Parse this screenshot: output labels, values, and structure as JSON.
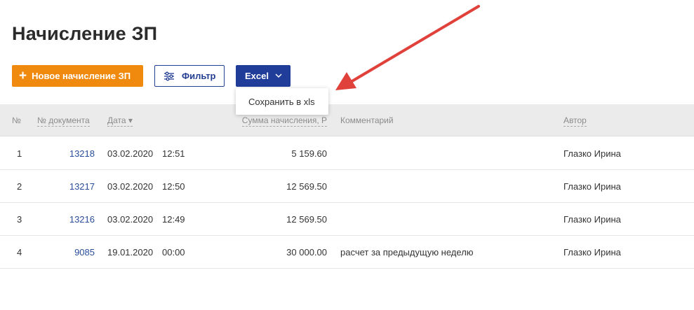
{
  "page": {
    "title": "Начисление ЗП"
  },
  "toolbar": {
    "new_label": "Новое начисление ЗП",
    "new_icon": "plus-icon",
    "filter_label": "Фильтр",
    "filter_icon": "sliders-icon",
    "excel_label": "Excel",
    "excel_icon": "chevron-down-icon"
  },
  "dropdown": {
    "items": [
      {
        "label": "Сохранить в xls"
      }
    ]
  },
  "table": {
    "headers": {
      "num": "№",
      "doc": "№ документа",
      "date": "Дата ▾",
      "sum": "Сумма начисления, Р",
      "comment": "Комментарий",
      "author": "Автор"
    },
    "rows": [
      {
        "num": "1",
        "doc": "13218",
        "date": "03.02.2020",
        "time": "12:51",
        "sum": "5 159.60",
        "comment": "",
        "author": "Глазко Ирина"
      },
      {
        "num": "2",
        "doc": "13217",
        "date": "03.02.2020",
        "time": "12:50",
        "sum": "12 569.50",
        "comment": "",
        "author": "Глазко Ирина"
      },
      {
        "num": "3",
        "doc": "13216",
        "date": "03.02.2020",
        "time": "12:49",
        "sum": "12 569.50",
        "comment": "",
        "author": "Глазко Ирина"
      },
      {
        "num": "4",
        "doc": "9085",
        "date": "19.01.2020",
        "time": "00:00",
        "sum": "30 000.00",
        "comment": "расчет за предыдущую неделю",
        "author": "Глазко Ирина"
      }
    ]
  },
  "colors": {
    "primary_orange": "#ef8a0e",
    "primary_blue": "#1f3d99",
    "link_blue": "#2a4d9b",
    "annotation_red": "#e0413a",
    "header_bg": "#ebebeb"
  },
  "annotation": {
    "icon": "red-arrow-icon"
  }
}
